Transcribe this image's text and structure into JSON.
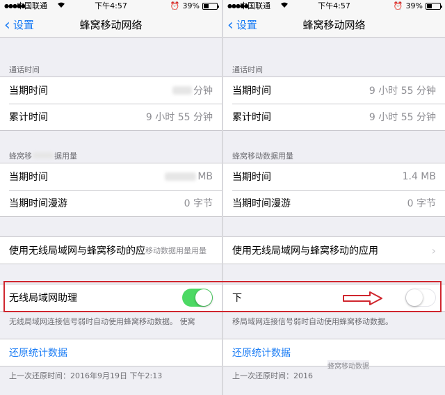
{
  "left": {
    "status": {
      "carrier": "中国联通",
      "time": "下午4:57",
      "battery": "39%"
    },
    "nav": {
      "back": "设置",
      "title": "蜂窝移动网络"
    },
    "call_time": {
      "header": "通话时间",
      "rows": [
        {
          "label": "当期时间",
          "value": "分钟"
        },
        {
          "label": "累计时间",
          "value": "9 小时 55 分钟"
        }
      ]
    },
    "data_usage": {
      "header": "蜂窝移",
      "header_suffix": "据用量",
      "rows": [
        {
          "label": "当期时间",
          "value": "MB"
        },
        {
          "label": "当期时间漫游",
          "value": "0 字节"
        }
      ]
    },
    "apps_row": {
      "label": "使用无线局域网与蜂窝移动的应",
      "overlay": "移动数据用量用量"
    },
    "wifi_assist": {
      "label": "无线局域网助理",
      "on": true
    },
    "wifi_assist_note": "无线局域网连接信号弱时自动使用蜂窝移动数据。  使窝",
    "reset": {
      "label": "还原统计数据",
      "note": "上一次还原时间：2016年9月19日 下午2:13"
    }
  },
  "right": {
    "status": {
      "carrier": "中国联通",
      "time": "下午4:57",
      "battery": "39%"
    },
    "nav": {
      "back": "设置",
      "title": "蜂窝移动网络"
    },
    "call_time": {
      "header": "通话时间",
      "rows": [
        {
          "label": "当期时间",
          "value": "9 小时 55 分钟"
        },
        {
          "label": "累计时间",
          "value": "9 小时 55 分钟"
        }
      ]
    },
    "data_usage": {
      "header": "蜂窝移动数据用量",
      "rows": [
        {
          "label": "当期时间",
          "value": "1.4 MB"
        },
        {
          "label": "当期时间漫游",
          "value": "0 字节"
        }
      ]
    },
    "apps_row": {
      "label": "使用无线局域网与蜂窝移动的应用"
    },
    "wifi_assist": {
      "label": "下",
      "on": false
    },
    "wifi_assist_note": "移局域网连接信号弱时自动使用蜂窝移动数据。",
    "reset": {
      "label": "还原统计数据",
      "note": "上一次还原时间：2016",
      "overlay": "蜂窝移动数据"
    }
  },
  "colors": {
    "accent": "#1a7cf5",
    "toggle_on": "#4cd964",
    "highlight": "#d0262e"
  }
}
